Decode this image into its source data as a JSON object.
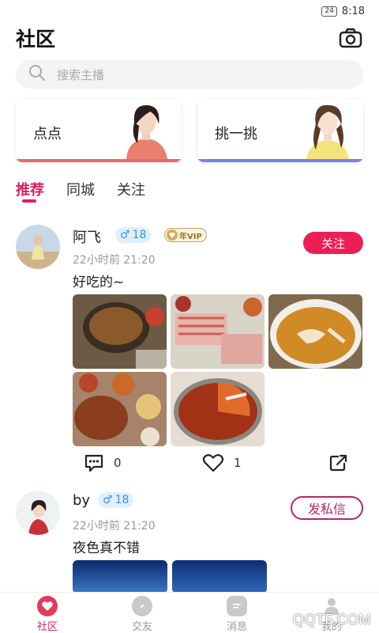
{
  "status_bar": {
    "battery": "24",
    "time": "8:18"
  },
  "header": {
    "title": "社区"
  },
  "search": {
    "placeholder": "搜索主播"
  },
  "banners": [
    {
      "label": "点点",
      "accent": "#e46a76"
    },
    {
      "label": "挑一挑",
      "accent": "#7b7fe8"
    }
  ],
  "tabs": [
    {
      "label": "推荐",
      "active": true
    },
    {
      "label": "同城",
      "active": false
    },
    {
      "label": "关注",
      "active": false
    }
  ],
  "posts": [
    {
      "name": "阿飞",
      "gender_symbol": "♂",
      "age": "18",
      "vip_label": "年VIP",
      "time": "22小时前 21:20",
      "text": "好吃的~",
      "action_label": "关注",
      "comments": "0",
      "likes": "1"
    },
    {
      "name": "by",
      "gender_symbol": "♂",
      "age": "18",
      "time": "22小时前 21:20",
      "text": "夜色真不错",
      "action_label": "发私信"
    }
  ],
  "tabbar": [
    {
      "label": "社区",
      "active": true
    },
    {
      "label": "交友",
      "active": false
    },
    {
      "label": "消息",
      "active": false
    },
    {
      "label": "我的",
      "active": false
    }
  ],
  "watermark": "QQTF.COM",
  "colors": {
    "accent": "#d62263",
    "follow": "#ec1f55",
    "male_badge": "#3a90dd"
  }
}
